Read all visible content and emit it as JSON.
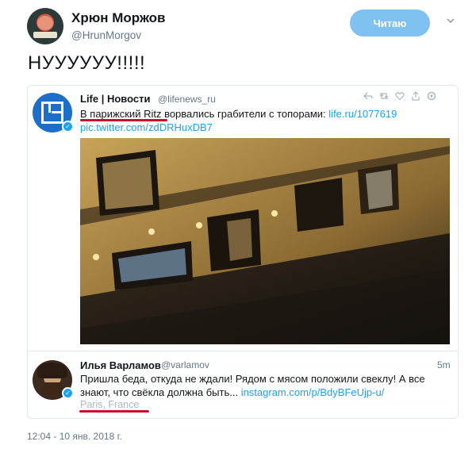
{
  "author": {
    "display_name": "Хрюн Моржов",
    "handle": "@HrunMorgov"
  },
  "follow_button": {
    "label": "Читаю"
  },
  "tweet": {
    "text": "НУУУУУУ!!!!!",
    "timestamp": "12:04 - 10 янв. 2018 г."
  },
  "quoted": {
    "name": "Life | Новости",
    "handle": "@lifenews_ru",
    "text_part1": "В парижский Ritz ворвались грабители с топорами: ",
    "link1": "life.ru/1077619",
    "link2": "pic.twitter.com/zdDRHuxDB7",
    "action_icons": [
      "reply-icon",
      "retweet-icon",
      "like-icon",
      "share-icon",
      "gear-icon"
    ]
  },
  "reply": {
    "name": "Илья Варламов",
    "handle": "@varlamov",
    "time": "5m",
    "line1": "Пришла беда, откуда не ждали! Рядом с мясом положили свеклу! А все",
    "line2_text": "знают, что свёкла должна быть... ",
    "line2_link": "instagram.com/p/BdyBFeUjp-u/",
    "location": "Paris, France"
  },
  "colors": {
    "link": "#1da1f2",
    "follow_button": "#7fc1f0",
    "underline": "#c8102e",
    "life_brand": "#1b6fc9"
  }
}
